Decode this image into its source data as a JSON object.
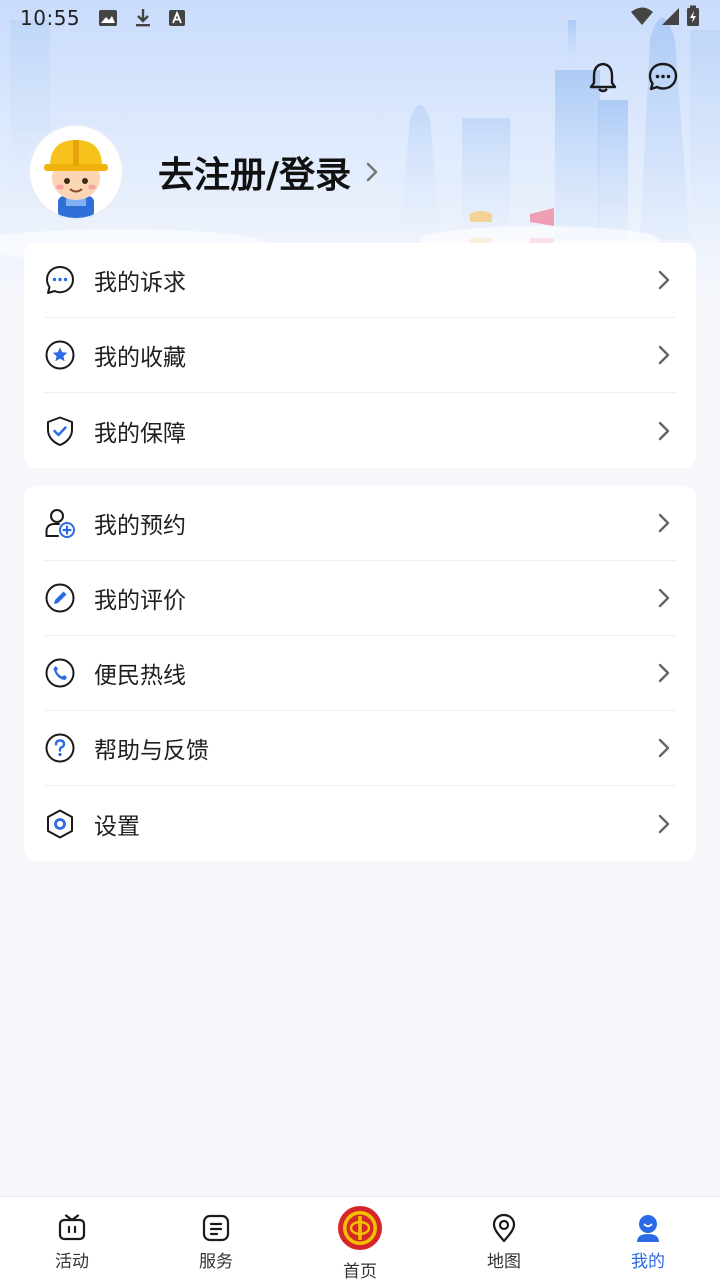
{
  "status_bar": {
    "time": "10:55"
  },
  "profile": {
    "login_label": "去注册/登录"
  },
  "menu_group_1": [
    {
      "label": "我的诉求",
      "icon": "chat-bubble-icon"
    },
    {
      "label": "我的收藏",
      "icon": "star-badge-icon"
    },
    {
      "label": "我的保障",
      "icon": "shield-check-icon"
    }
  ],
  "menu_group_2": [
    {
      "label": "我的预约",
      "icon": "user-add-icon"
    },
    {
      "label": "我的评价",
      "icon": "pencil-icon"
    },
    {
      "label": "便民热线",
      "icon": "phone-icon"
    },
    {
      "label": "帮助与反馈",
      "icon": "question-icon"
    },
    {
      "label": "设置",
      "icon": "settings-hex-icon"
    }
  ],
  "tabs": [
    {
      "label": "活动",
      "icon": "gift-tv-icon",
      "active": false
    },
    {
      "label": "服务",
      "icon": "service-list-icon",
      "active": false
    },
    {
      "label": "首页",
      "icon": "union-logo-icon",
      "active": false
    },
    {
      "label": "地图",
      "icon": "map-pin-icon",
      "active": false
    },
    {
      "label": "我的",
      "icon": "user-icon",
      "active": true
    }
  ],
  "colors": {
    "accent": "#2a6ae6",
    "logo_red": "#d7262b",
    "logo_gold": "#f2c200"
  }
}
